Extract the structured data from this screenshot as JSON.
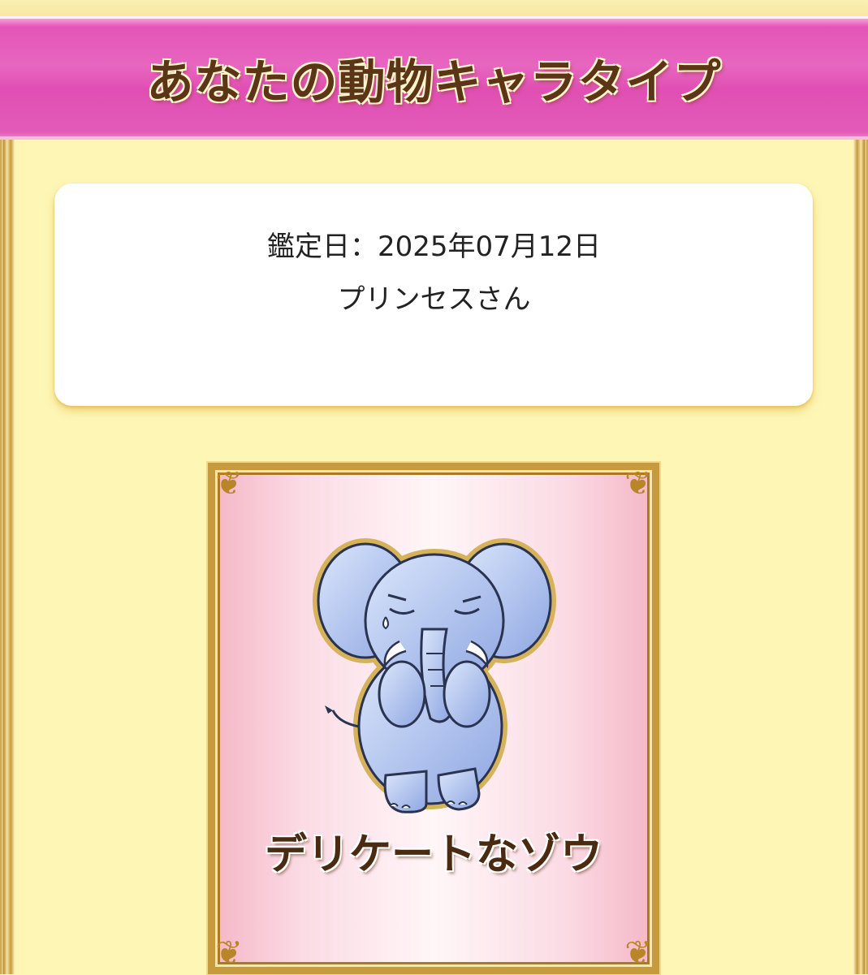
{
  "header": {
    "title": "あなたの動物キャラタイプ"
  },
  "result": {
    "date_line": "鑑定日：2025年07月12日",
    "name_line": "プリンセスさん"
  },
  "character": {
    "name": "デリケートなゾウ",
    "image_icon": "elephant-icon"
  },
  "colors": {
    "banner": "#e455b7",
    "background": "#fdf6b5",
    "frame_gold": "#c79a3e",
    "card_pink": "#f5b7c6"
  }
}
